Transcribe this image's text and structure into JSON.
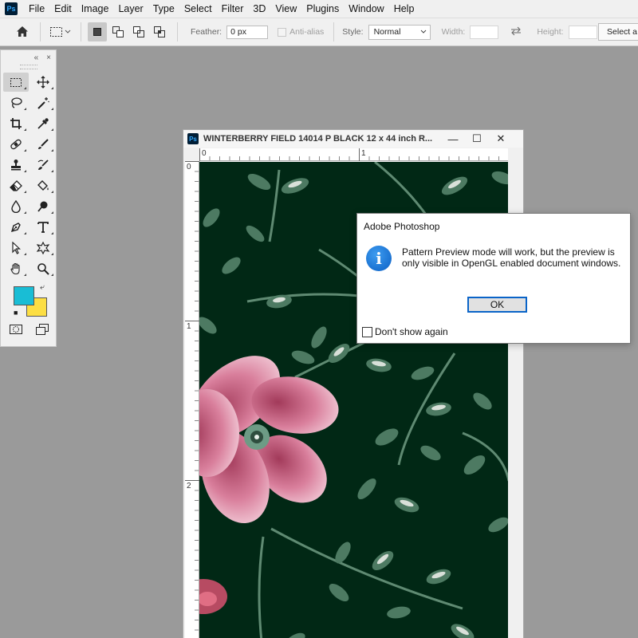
{
  "app": {
    "logo": "Ps"
  },
  "menu": [
    "File",
    "Edit",
    "Image",
    "Layer",
    "Type",
    "Select",
    "Filter",
    "3D",
    "View",
    "Plugins",
    "Window",
    "Help"
  ],
  "options": {
    "feather_label": "Feather:",
    "feather_value": "0 px",
    "antialias_label": "Anti-alias",
    "style_label": "Style:",
    "style_value": "Normal",
    "width_label": "Width:",
    "height_label": "Height:",
    "select_button": "Select a"
  },
  "toolbar": {
    "collapse": "«",
    "close": "×",
    "tools": [
      "rectangular-marquee-icon",
      "move-icon",
      "lasso-icon",
      "magic-wand-icon",
      "crop-icon",
      "eyedropper-icon",
      "healing-brush-icon",
      "brush-icon",
      "clone-stamp-icon",
      "history-brush-icon",
      "eraser-icon",
      "paint-bucket-icon",
      "blur-icon",
      "dodge-icon",
      "pen-icon",
      "type-icon",
      "path-selection-icon",
      "custom-shape-icon",
      "hand-icon",
      "zoom-icon"
    ],
    "foreground_color": "#19bdd5",
    "background_color": "#fcde43"
  },
  "document": {
    "title": "WINTERBERRY FIELD  14014 P  BLACK  12 x 44 inch R...",
    "ruler_top": [
      "0",
      "1"
    ],
    "ruler_left": [
      "0",
      "1",
      "2"
    ],
    "minimize": "—",
    "maximize": "☐",
    "close": "✕"
  },
  "dialog": {
    "title": "Adobe Photoshop",
    "icon": "i",
    "message": "Pattern Preview mode will work, but the preview is only visible in OpenGL enabled document windows.",
    "ok_label": "OK",
    "checkbox_label": "Don't show again"
  }
}
